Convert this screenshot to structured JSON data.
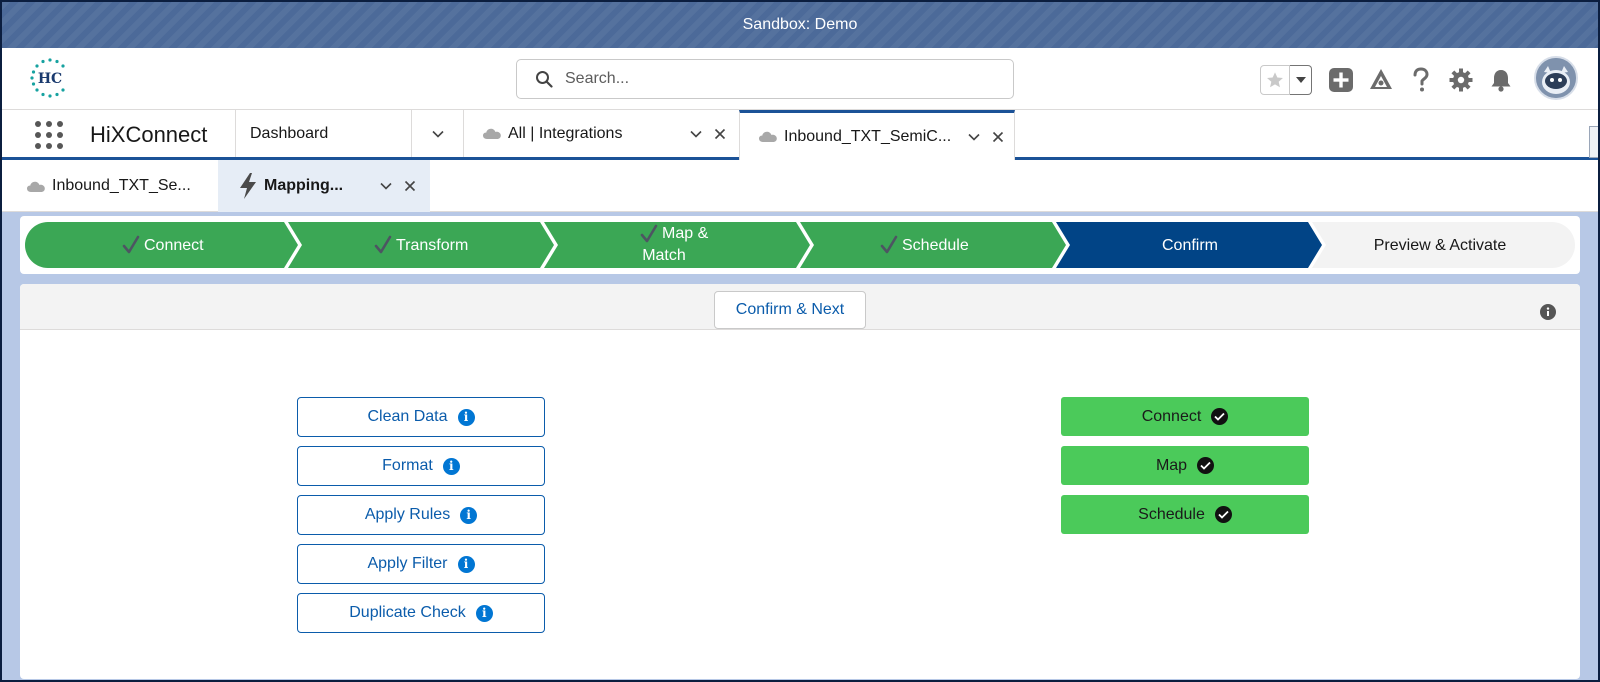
{
  "sandbox_banner": "Sandbox: Demo",
  "header": {
    "logo_text": "HC",
    "search_placeholder": "Search...",
    "icons": [
      "favorites-star-icon",
      "favorites-dropdown-icon",
      "global-add-icon",
      "trailhead-icon",
      "help-icon",
      "setup-gear-icon",
      "notifications-bell-icon",
      "user-avatar"
    ]
  },
  "app_nav": {
    "app_name": "HiXConnect",
    "tabs": [
      {
        "label": "Dashboard"
      },
      {
        "label": "All | Integrations"
      },
      {
        "label": "Inbound_TXT_SemiC..."
      }
    ]
  },
  "sub_tabs": [
    {
      "label": "Inbound_TXT_Se..."
    },
    {
      "label": "Mapping..."
    }
  ],
  "path": {
    "steps": [
      {
        "label": "Connect",
        "state": "complete"
      },
      {
        "label": "Transform",
        "state": "complete"
      },
      {
        "label_line1": "Map &",
        "label_line2": "Match",
        "state": "complete"
      },
      {
        "label": "Schedule",
        "state": "complete"
      },
      {
        "label": "Confirm",
        "state": "current"
      },
      {
        "label": "Preview & Activate",
        "state": "incomplete"
      }
    ],
    "colors": {
      "complete": "#3ba755",
      "current": "#014486",
      "incomplete": "#f3f3f3"
    }
  },
  "panel": {
    "confirm_next_label": "Confirm & Next",
    "options": [
      {
        "label": "Clean Data"
      },
      {
        "label": "Format"
      },
      {
        "label": "Apply Rules"
      },
      {
        "label": "Apply Filter"
      },
      {
        "label": "Duplicate Check"
      }
    ],
    "completed": [
      {
        "label": "Connect"
      },
      {
        "label": "Map"
      },
      {
        "label": "Schedule"
      }
    ]
  },
  "colors": {
    "brand_blue": "#0b5cab",
    "info_blue": "#0176d3",
    "success_green": "#4bca5a",
    "banner": "#4c6a99"
  }
}
